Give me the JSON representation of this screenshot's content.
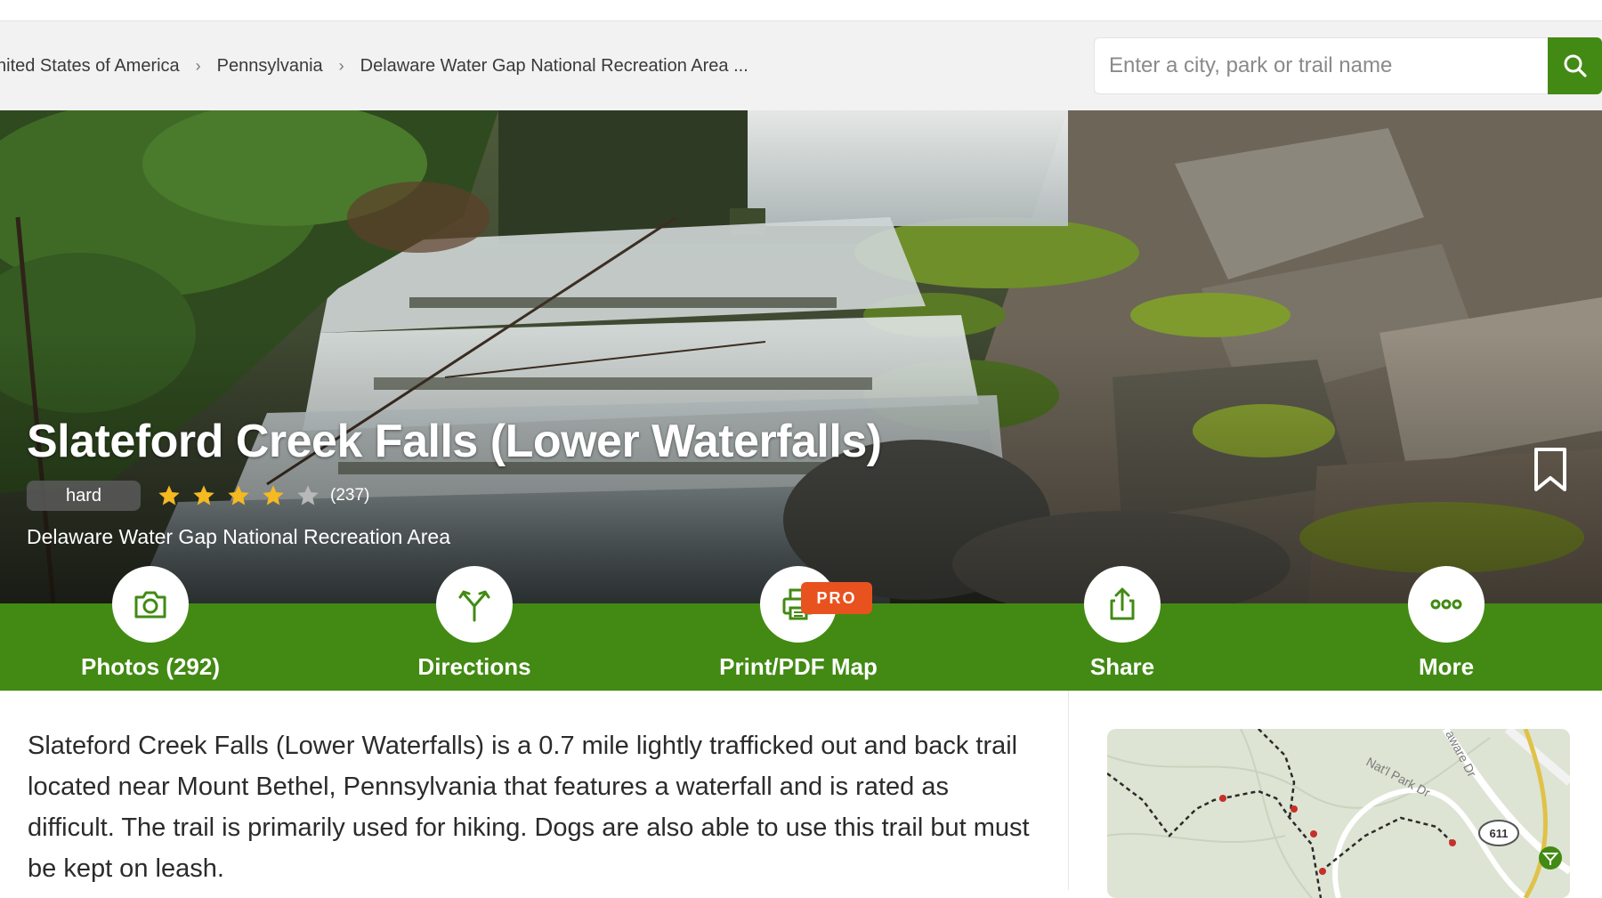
{
  "breadcrumb": {
    "items": [
      "nited States of America",
      "Pennsylvania",
      "Delaware Water Gap National Recreation Area ..."
    ],
    "separator": "›"
  },
  "search": {
    "placeholder": "Enter a city, park or trail name",
    "icon": "search-icon"
  },
  "trail": {
    "title": "Slateford Creek Falls (Lower Waterfalls)",
    "difficulty": "hard",
    "rating": 4,
    "rating_max": 5,
    "review_count": "(237)",
    "park": "Delaware Water Gap National Recreation Area"
  },
  "actions": [
    {
      "label": "Photos (292)",
      "icon": "camera-icon"
    },
    {
      "label": "Directions",
      "icon": "directions-icon"
    },
    {
      "label": "Print/PDF Map",
      "icon": "printer-icon",
      "badge": "PRO"
    },
    {
      "label": "Share",
      "icon": "share-icon"
    },
    {
      "label": "More",
      "icon": "more-icon"
    }
  ],
  "description": "Slateford Creek Falls (Lower Waterfalls) is a 0.7 mile lightly trafficked out and back trail located near Mount Bethel, Pennsylvania that features a waterfall and is rated as difficult. The trail is primarily used for hiking. Dogs are also able to use this trail but must be kept on leash.",
  "map": {
    "road_label_1": "Nat'l Park Dr",
    "road_label_2": "aware Dr",
    "route_shield": "611"
  },
  "colors": {
    "brand_green": "#428a13",
    "pro_orange": "#e8521f",
    "star_gold": "#f5b921"
  }
}
